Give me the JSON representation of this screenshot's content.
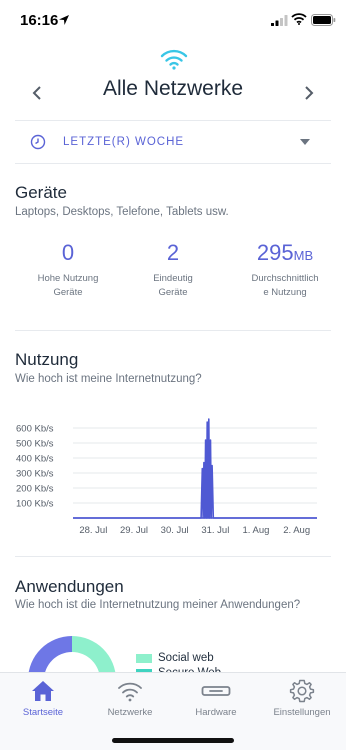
{
  "status_bar": {
    "time": "16:16",
    "icons": [
      "location-arrow-icon",
      "cellular-signal-icon",
      "wifi-icon",
      "battery-icon"
    ]
  },
  "header": {
    "logo_icon": "wifi-logo-icon",
    "title": "Alle Netzwerke",
    "prev_icon": "chevron-left-icon",
    "next_icon": "chevron-right-icon"
  },
  "period": {
    "label": "LETZTE(R) WOCHE",
    "icon": "clock-icon",
    "dropdown_icon": "caret-down-icon"
  },
  "devices": {
    "title": "Geräte",
    "subtitle": "Laptops, Desktops, Telefone, Tablets usw.",
    "stats": [
      {
        "value": "0",
        "unit": "",
        "label_line1": "Hohe Nutzung",
        "label_line2": "Geräte"
      },
      {
        "value": "2",
        "unit": "",
        "label_line1": "Eindeutig",
        "label_line2": "Geräte"
      },
      {
        "value": "295",
        "unit": "MB",
        "label_line1": "Durchschnittlich",
        "label_line2": "e Nutzung"
      }
    ]
  },
  "usage": {
    "title": "Nutzung",
    "subtitle": "Wie hoch ist meine Internetnutzung?"
  },
  "chart_data": {
    "type": "line",
    "title": "",
    "xlabel": "",
    "ylabel": "",
    "series_color": "#4f59d3",
    "y_ticks": [
      "100 Kb/s",
      "200 Kb/s",
      "300 Kb/s",
      "400 Kb/s",
      "500 Kb/s",
      "600 Kb/s"
    ],
    "x_ticks": [
      "28. Jul",
      "29. Jul",
      "30. Jul",
      "31. Jul",
      "1. Aug",
      "2. Aug"
    ],
    "ylim": [
      0,
      700
    ],
    "xlim": [
      0,
      6
    ],
    "grid": true,
    "x": [
      0,
      1,
      2,
      2.9,
      3.15,
      3.18,
      3.2,
      3.22,
      3.24,
      3.26,
      3.28,
      3.3,
      3.32,
      3.34,
      3.36,
      3.38,
      3.4,
      3.42,
      3.45,
      4,
      5,
      6
    ],
    "y": [
      0,
      0,
      0,
      0,
      0,
      330,
      0,
      370,
      0,
      520,
      0,
      640,
      0,
      660,
      0,
      520,
      0,
      350,
      0,
      0,
      0,
      0
    ]
  },
  "apps": {
    "title": "Anwendungen",
    "subtitle": "Wie hoch ist die Internetnutzung meiner Anwendungen?",
    "donut_colors": [
      "#6e77e6",
      "#8ef0cc"
    ],
    "legend": [
      {
        "label": "Social web",
        "color": "#8ef0cc"
      },
      {
        "label": "Secure Web",
        "color": "#3fd3c0"
      }
    ]
  },
  "tabbar": {
    "accent": "#5a63d6",
    "tabs": [
      {
        "label": "Startseite",
        "icon": "home-icon",
        "active": true
      },
      {
        "label": "Netzwerke",
        "icon": "wifi-icon",
        "active": false
      },
      {
        "label": "Hardware",
        "icon": "router-icon",
        "active": false
      },
      {
        "label": "Einstellungen",
        "icon": "gear-icon",
        "active": false
      }
    ]
  }
}
